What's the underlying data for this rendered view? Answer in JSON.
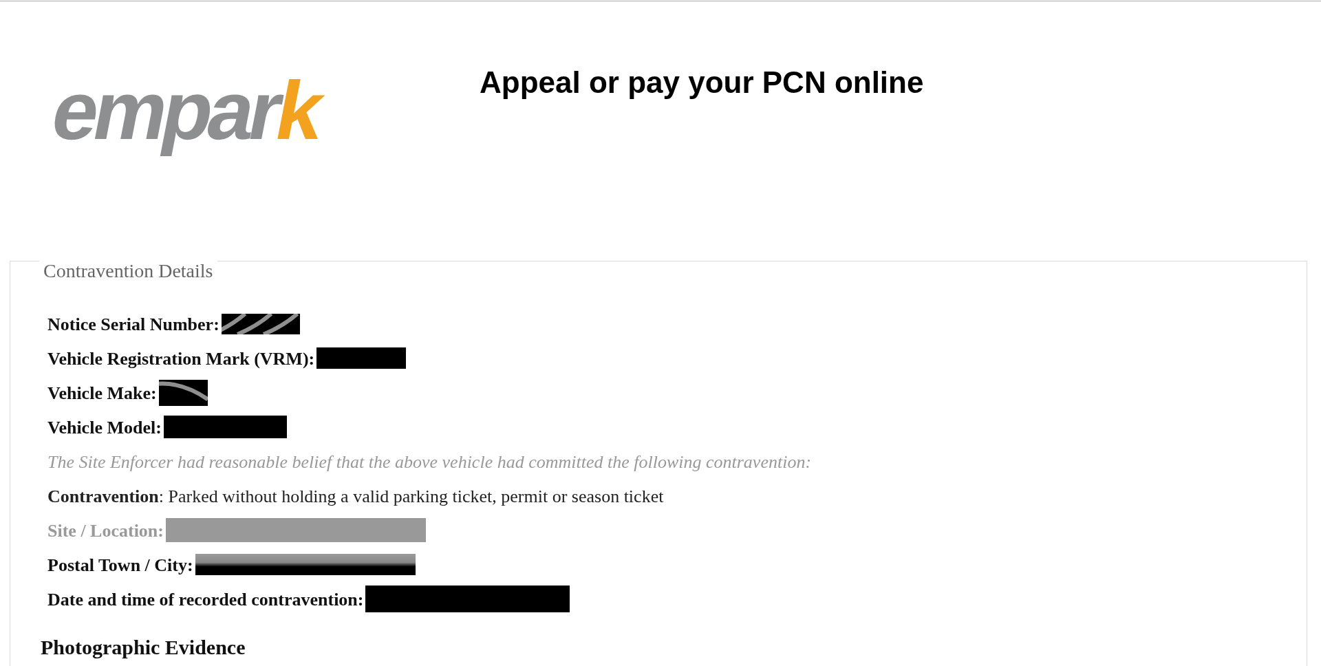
{
  "header": {
    "logo": "empark",
    "title": "Appeal or pay your PCN online"
  },
  "panel": {
    "legend": "Contravention Details",
    "rows": [
      {
        "kind": "field",
        "label": "Notice Serial Number:",
        "greyed": false,
        "streaked": true,
        "half_grey": false
      },
      {
        "kind": "field",
        "label": "Vehicle Registration Mark (VRM):",
        "greyed": false,
        "streaked": false,
        "half_grey": false
      },
      {
        "kind": "field",
        "label": "Vehicle Make:",
        "greyed": false,
        "streaked": true,
        "half_grey": false
      },
      {
        "kind": "field",
        "label": "Vehicle Model:",
        "greyed": false,
        "streaked": false,
        "half_grey": false
      },
      {
        "kind": "note",
        "text": "The Site Enforcer had reasonable belief that the above vehicle had committed the following contravention:"
      },
      {
        "kind": "statement",
        "text": "**Contravention**: Parked without holding a valid parking ticket, permit or season ticket"
      },
      {
        "kind": "field",
        "label": "Site / Location:",
        "greyed": true,
        "streaked": false,
        "half_grey": false
      },
      {
        "kind": "field",
        "label": "Postal Town / City:",
        "greyed": false,
        "streaked": false,
        "half_grey": true
      },
      {
        "kind": "field",
        "label": "Date and time of recorded contravention:",
        "greyed": false,
        "streaked": false,
        "half_grey": false
      }
    ],
    "section_heading": "Photographic Evidence"
  }
}
